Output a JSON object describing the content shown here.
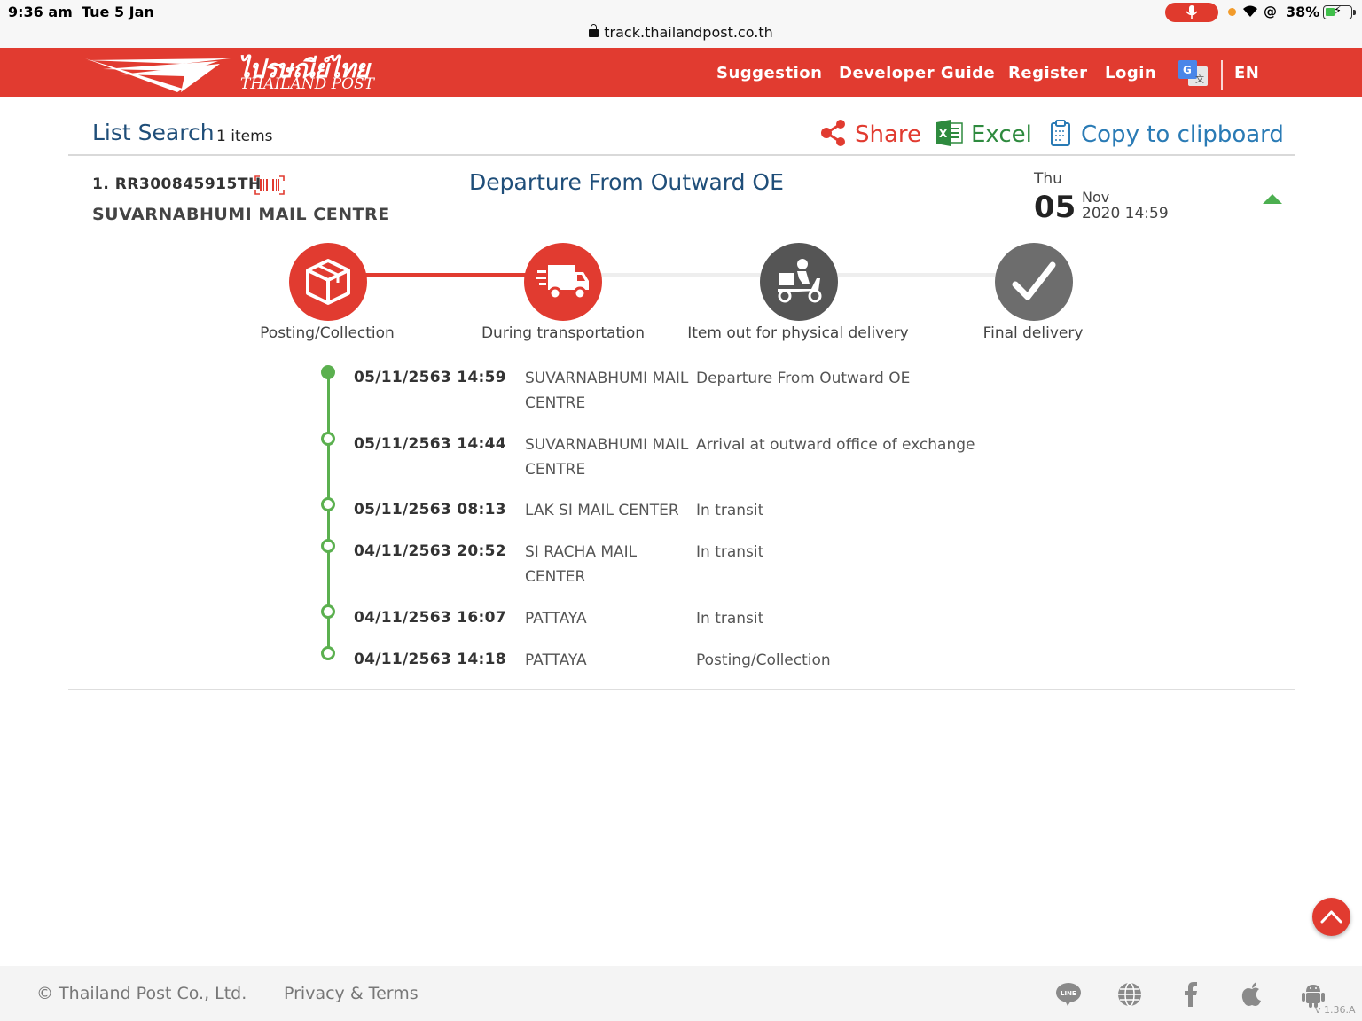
{
  "status_bar": {
    "time": "9:36 am",
    "date": "Tue 5 Jan",
    "url": "track.thailandpost.co.th",
    "battery_percent": "38%",
    "battery_level": 0.38
  },
  "header": {
    "logo_thai": "ไปรษณีย์ไทย",
    "logo_en": "THAILAND POST",
    "nav": [
      "Suggestion",
      "Developer Guide",
      "Register",
      "Login"
    ],
    "language": "EN",
    "colors": {
      "brand_red": "#e13b30"
    }
  },
  "list_search": {
    "title": "List Search",
    "count": "1 items",
    "actions": {
      "share": "Share",
      "excel": "Excel",
      "copy": "Copy to clipboard"
    }
  },
  "item": {
    "number": "1. RR300845915TH",
    "office": "SUVARNABHUMI MAIL CENTRE",
    "status": "Departure From Outward OE",
    "day_name": "Thu",
    "day": "05",
    "month": "Nov",
    "year_time": "2020  14:59"
  },
  "steps": [
    {
      "label": "Posting/Collection",
      "icon": "box-icon",
      "state": "done"
    },
    {
      "label": "During transportation",
      "icon": "truck-icon",
      "state": "done"
    },
    {
      "label": "Item out for physical delivery",
      "icon": "scooter-icon",
      "state": "pending"
    },
    {
      "label": "Final delivery",
      "icon": "checkmark-icon",
      "state": "pending"
    }
  ],
  "timeline": [
    {
      "datetime": "05/11/2563 14:59",
      "location": "SUVARNABHUMI MAIL CENTRE",
      "description": "Departure From Outward OE"
    },
    {
      "datetime": "05/11/2563 14:44",
      "location": "SUVARNABHUMI MAIL CENTRE",
      "description": "Arrival at outward office of exchange"
    },
    {
      "datetime": "05/11/2563 08:13",
      "location": "LAK SI MAIL CENTER",
      "description": "In transit"
    },
    {
      "datetime": "04/11/2563 20:52",
      "location": "SI RACHA MAIL CENTER",
      "description": "In transit"
    },
    {
      "datetime": "04/11/2563 16:07",
      "location": "PATTAYA",
      "description": "In transit"
    },
    {
      "datetime": "04/11/2563 14:18",
      "location": "PATTAYA",
      "description": "Posting/Collection"
    }
  ],
  "footer": {
    "copyright": "© Thailand Post Co., Ltd.",
    "privacy": "Privacy & Terms",
    "icons": [
      "line-icon",
      "globe-icon",
      "facebook-icon",
      "apple-icon",
      "android-icon"
    ],
    "version": "v 1.36.A"
  }
}
